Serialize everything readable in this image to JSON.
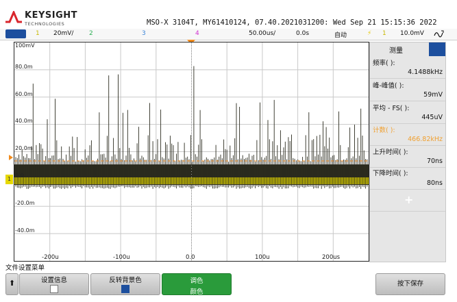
{
  "header": {
    "brand": "KEYSIGHT",
    "brand_sub": "TECHNOLOGIES",
    "instrument_info": "MSO-X 3104T, MY61410124, 07.40.2021031200: Wed Sep 21 15:15:36 2022"
  },
  "channel_bar": {
    "ch1_number": "1",
    "ch1_scale": "20mV/",
    "ch2_number": "2",
    "ch3_number": "3",
    "ch4_number": "4",
    "timebase": "50.00us/",
    "delay": "0.0s",
    "trigger_mode": "自动",
    "trigger_source": "1",
    "trigger_level": "10.0mV",
    "colors": {
      "ch1": "#e6d800",
      "ch2": "#3cd66a",
      "ch3": "#3d86d8",
      "ch4": "#e040e0",
      "run_badge": "#1d4f9e"
    }
  },
  "grid": {
    "y_labels": [
      "100mV",
      "80.0m",
      "60.0m",
      "40.0m",
      "20.0m",
      "0.0",
      "-20.0m",
      "-40.0m"
    ],
    "x_labels": [
      "-200u",
      "-100u",
      "0.0",
      "100u",
      "200us"
    ],
    "ground_marker": "1"
  },
  "measure": {
    "title": "测量",
    "items": [
      {
        "label": "频率(  ):",
        "value": "4.1488kHz",
        "color": "#111111"
      },
      {
        "label": "峰-峰值(  ):",
        "value": "59mV",
        "color": "#111111"
      },
      {
        "label": "平均 - FS(  ):",
        "value": "445uV",
        "color": "#111111"
      },
      {
        "label": "计数(  ):",
        "value": "466.82kHz",
        "color": "#f0a030"
      },
      {
        "label": "上升时间(  ):",
        "value": "70ns",
        "color": "#111111"
      },
      {
        "label": "下降时间(  ):",
        "value": "80ns",
        "color": "#111111"
      }
    ],
    "add_symbol": "+"
  },
  "softkeys": {
    "menu_title": "文件设置菜单",
    "up_arrow": "⬆",
    "settings_info": "设置信息",
    "invert_bg": "反转背景色",
    "palette_line1": "调色",
    "palette_line2": "颜色",
    "save_label": "按下保存"
  },
  "chart_data": {
    "type": "line",
    "series": [
      {
        "values": [
          -5,
          10
        ]
      }
    ],
    "x_range": [
      -250,
      250
    ],
    "y_range": [
      -50,
      100
    ],
    "grid": true,
    "notes_level": "noise band approx -5mV to 10mV with spikes up to 85mV"
  }
}
